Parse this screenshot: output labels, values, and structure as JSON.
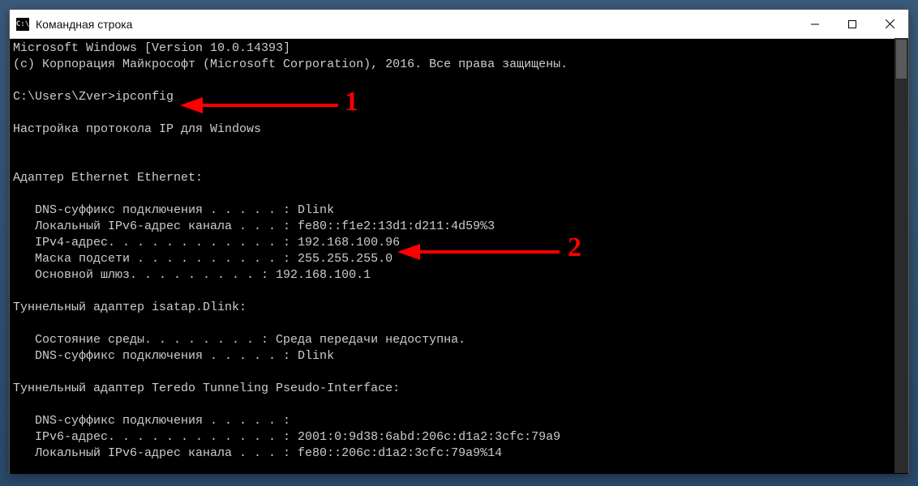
{
  "window": {
    "title": "Командная строка",
    "icon_text": "C:\\"
  },
  "terminal": {
    "lines": [
      "Microsoft Windows [Version 10.0.14393]",
      "(c) Корпорация Майкрософт (Microsoft Corporation), 2016. Все права защищены.",
      "",
      "C:\\Users\\Zver>ipconfig",
      "",
      "Настройка протокола IP для Windows",
      "",
      "",
      "Адаптер Ethernet Ethernet:",
      "",
      "   DNS-суффикс подключения . . . . . : Dlink",
      "   Локальный IPv6-адрес канала . . . : fe80::f1e2:13d1:d211:4d59%3",
      "   IPv4-адрес. . . . . . . . . . . . : 192.168.100.96",
      "   Маска подсети . . . . . . . . . . : 255.255.255.0",
      "   Основной шлюз. . . . . . . . . : 192.168.100.1",
      "",
      "Туннельный адаптер isatap.Dlink:",
      "",
      "   Состояние среды. . . . . . . . : Среда передачи недоступна.",
      "   DNS-суффикс подключения . . . . . : Dlink",
      "",
      "Туннельный адаптер Teredo Tunneling Pseudo-Interface:",
      "",
      "   DNS-суффикс подключения . . . . . :",
      "   IPv6-адрес. . . . . . . . . . . . : 2001:0:9d38:6abd:206c:d1a2:3cfc:79a9",
      "   Локальный IPv6-адрес канала . . . : fe80::206c:d1a2:3cfc:79a9%14"
    ]
  },
  "annotations": {
    "label1": "1",
    "label2": "2"
  }
}
